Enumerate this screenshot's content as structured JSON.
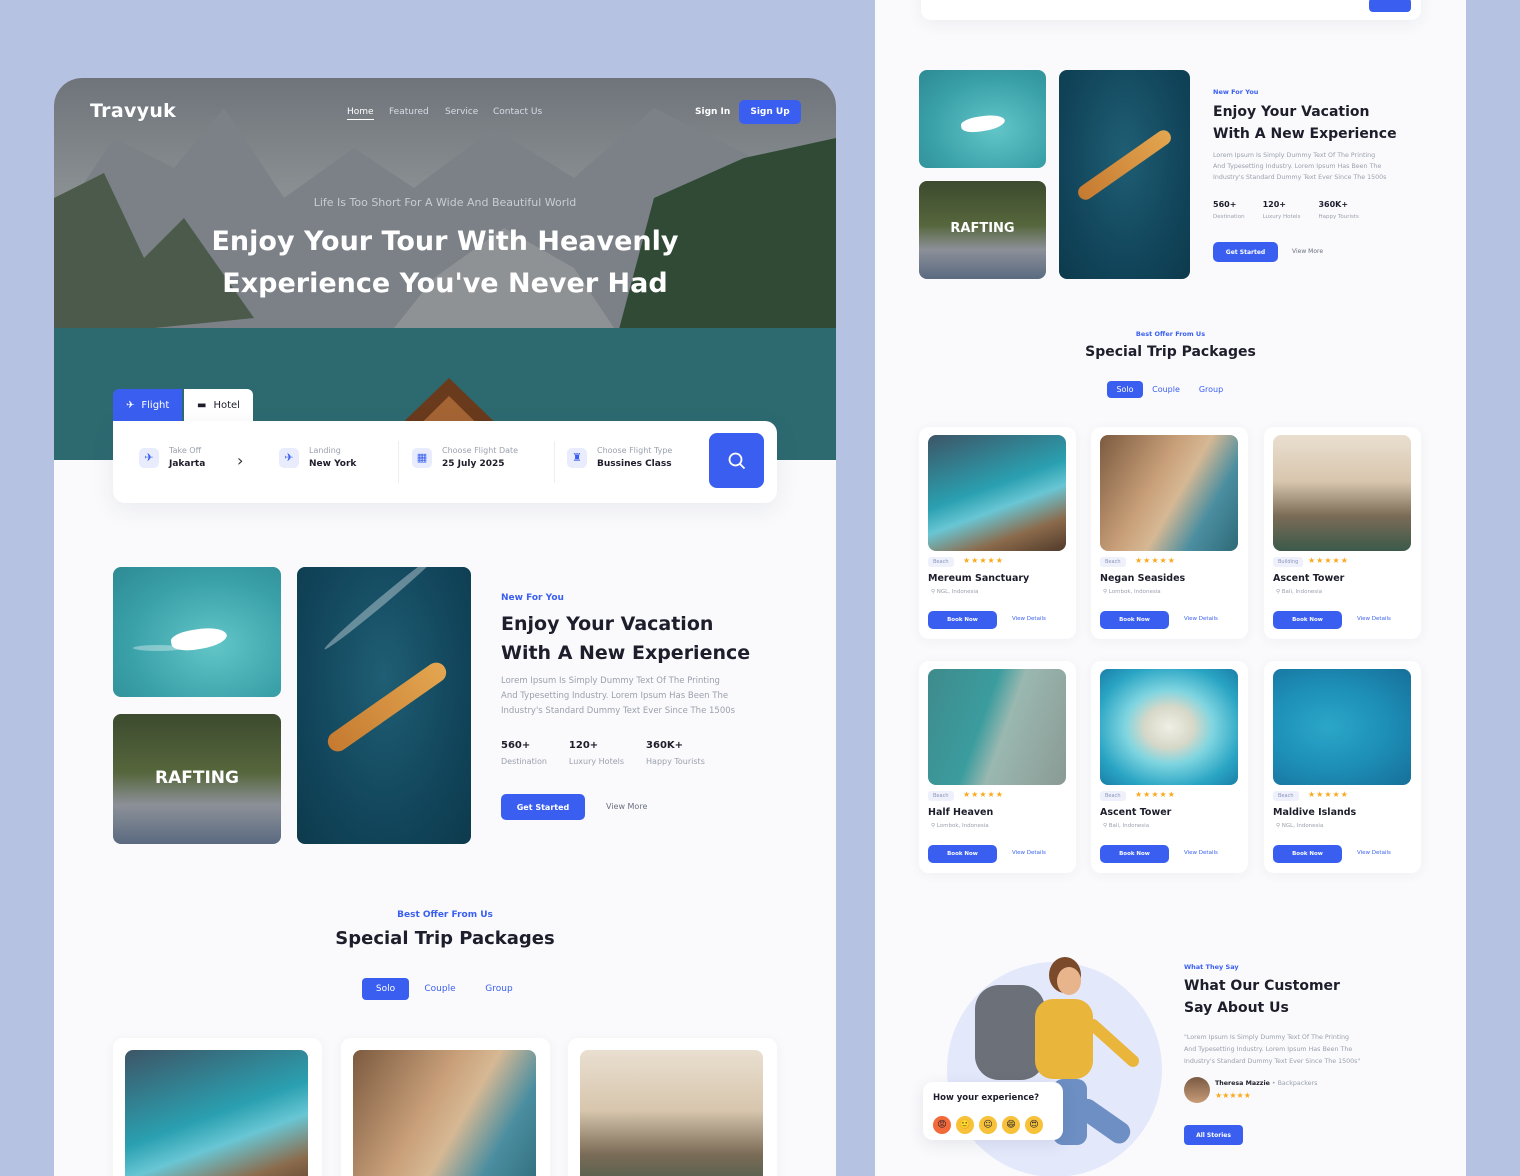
{
  "nav": {
    "logo": "Travyuk",
    "links": [
      "Home",
      "Featured",
      "Service",
      "Contact Us"
    ],
    "sign_in": "Sign In",
    "sign_up": "Sign Up"
  },
  "hero": {
    "tagline": "Life Is Too Short For A Wide And Beautiful World",
    "title_line1": "Enjoy Your Tour With Heavenly",
    "title_line2": "Experience You've Never Had"
  },
  "booking": {
    "tabs": [
      "Flight",
      "Hotel"
    ],
    "fields": [
      {
        "label": "Take Off",
        "value": "Jakarta"
      },
      {
        "label": "Landing",
        "value": "New York"
      },
      {
        "label": "Choose Flight Date",
        "value": "25 July 2025"
      },
      {
        "label": "Choose Flight Type",
        "value": "Bussines Class"
      }
    ]
  },
  "about": {
    "tag": "New For You",
    "title_line1": "Enjoy Your Vacation",
    "title_line2": "With A New Experience",
    "p1": "Lorem Ipsum Is Simply Dummy Text Of The Printing",
    "p2": "And Typesetting Industry. Lorem Ipsum Has Been The",
    "p3": "Industry's Standard Dummy Text Ever Since The 1500s",
    "stats": [
      {
        "n": "560+",
        "l": "Destination"
      },
      {
        "n": "120+",
        "l": "Luxury Hotels"
      },
      {
        "n": "360K+",
        "l": "Happy Tourists"
      }
    ],
    "cta": "Get Started",
    "more": "View More",
    "rafting": "RAFTING"
  },
  "packages": {
    "tag": "Best Offer From Us",
    "title": "Special Trip Packages",
    "filters": [
      "Solo",
      "Couple",
      "Group"
    ],
    "book": "Book Now",
    "view": "View Details",
    "items": [
      {
        "cat": "Beach",
        "name": "Mereum Sanctuary",
        "loc": "NGL, Indonesia",
        "rating": 5
      },
      {
        "cat": "Beach",
        "name": "Negan Seasides",
        "loc": "Lombok, Indonesia",
        "rating": 5
      },
      {
        "cat": "Building",
        "name": "Ascent Tower",
        "loc": "Bali, Indonesia",
        "rating": 5
      },
      {
        "cat": "Beach",
        "name": "Half Heaven",
        "loc": "Lombok, Indonesia",
        "rating": 5
      },
      {
        "cat": "Beach",
        "name": "Ascent Tower",
        "loc": "Bali, Indonesia",
        "rating": 5
      },
      {
        "cat": "Beach",
        "name": "Maldive Islands",
        "loc": "NGL, Indonesia",
        "rating": 5
      }
    ]
  },
  "testimonial": {
    "tag": "What They Say",
    "title_line1": "What Our Customer",
    "title_line2": "Say About Us",
    "q1": "\"Lorem Ipsum Is Simply Dummy Text Of The Printing",
    "q2": "And Typesetting Industry. Lorem Ipsum Has Been The",
    "q3": "Industry's Standard Dummy Text Ever Since The 1500s\"",
    "author": "Theresa Mazzie",
    "role": "Backpackers",
    "button": "All Stories",
    "question": "How your experience?",
    "emojis": [
      "😡",
      "🙂",
      "😐",
      "😄",
      "😍"
    ]
  },
  "colors": {
    "accent": "#3a5ff0",
    "star": "#f8a91c",
    "background": "#b6c2e2"
  }
}
